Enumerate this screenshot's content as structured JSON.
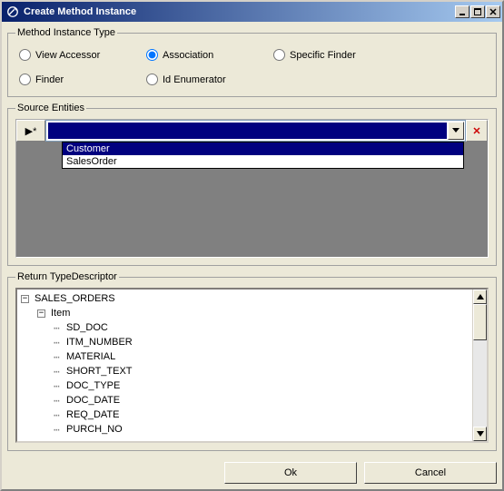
{
  "window": {
    "title": "Create Method Instance"
  },
  "method_instance_type": {
    "legend": "Method Instance Type",
    "options": {
      "view_accessor": "View Accessor",
      "association": "Association",
      "specific_finder": "Specific Finder",
      "finder": "Finder",
      "id_enumerator": "Id Enumerator"
    },
    "selected": "association"
  },
  "source_entities": {
    "legend": "Source Entities",
    "row_marker": "▶*",
    "dropdown_items": [
      "Customer",
      "SalesOrder"
    ],
    "selected_index": 0
  },
  "return_type_descriptor": {
    "legend": "Return TypeDescriptor",
    "tree": [
      {
        "label": "SALES_ORDERS",
        "depth": 0,
        "expanded": true
      },
      {
        "label": "Item",
        "depth": 1,
        "expanded": true
      },
      {
        "label": "SD_DOC",
        "depth": 2
      },
      {
        "label": "ITM_NUMBER",
        "depth": 2
      },
      {
        "label": "MATERIAL",
        "depth": 2
      },
      {
        "label": "SHORT_TEXT",
        "depth": 2
      },
      {
        "label": "DOC_TYPE",
        "depth": 2
      },
      {
        "label": "DOC_DATE",
        "depth": 2
      },
      {
        "label": "REQ_DATE",
        "depth": 2
      },
      {
        "label": "PURCH_NO",
        "depth": 2
      }
    ]
  },
  "buttons": {
    "ok": "Ok",
    "cancel": "Cancel"
  }
}
